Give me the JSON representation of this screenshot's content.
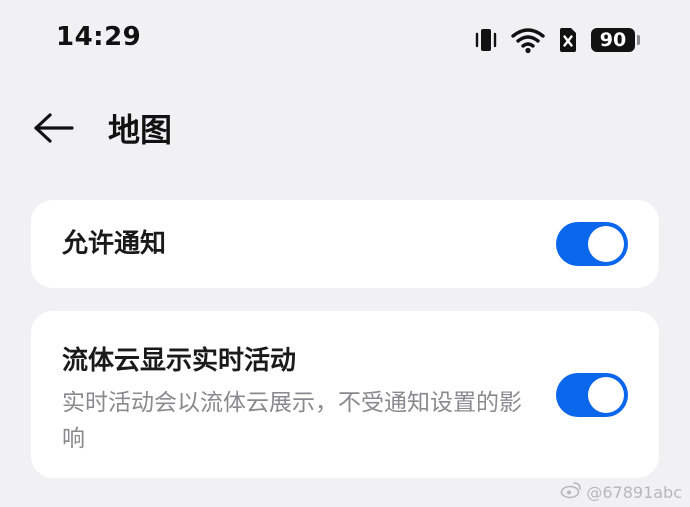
{
  "status_bar": {
    "time": "14:29",
    "battery_level": "90",
    "icons": [
      "vibrate-icon",
      "wifi-icon",
      "sim-off-icon",
      "battery-icon"
    ]
  },
  "header": {
    "title": "地图",
    "back_icon": "back-arrow-icon"
  },
  "settings": {
    "allow_notifications": {
      "label": "允许通知",
      "enabled": true
    },
    "live_activity": {
      "label": "流体云显示实时活动",
      "description": "实时活动会以流体云展示，不受通知设置的影响",
      "enabled": true
    }
  },
  "watermark": {
    "text": "@67891abc",
    "icon": "weibo-icon"
  },
  "colors": {
    "background": "#f1f1f3",
    "card": "#ffffff",
    "accent": "#0a66ea",
    "secondary_text": "#8a8a8e"
  }
}
